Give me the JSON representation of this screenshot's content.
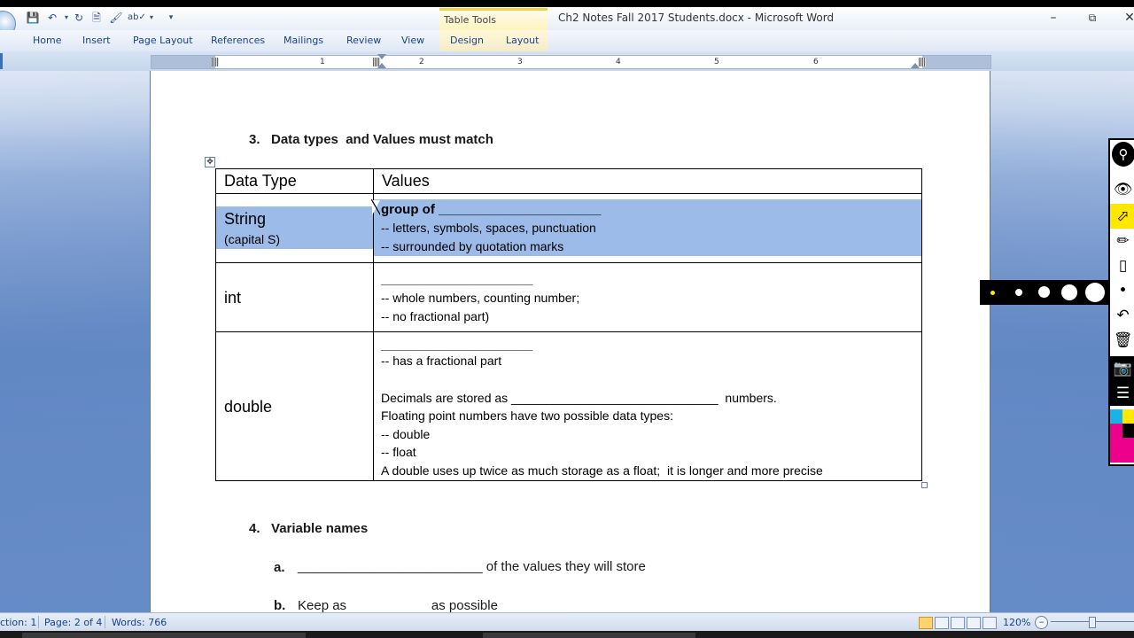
{
  "window": {
    "title": "Ch2 Notes Fall 2017 Students.docx - Microsoft Word",
    "context_tab_group": "Table Tools"
  },
  "ribbon_tabs": [
    "Home",
    "Insert",
    "Page Layout",
    "References",
    "Mailings",
    "Review",
    "View",
    "Design",
    "Layout"
  ],
  "ruler_numbers": [
    "1",
    "2",
    "3",
    "4",
    "5",
    "6"
  ],
  "document": {
    "heading3": "3.   Data types  and Values must match",
    "table": {
      "col1_header": "Data Type",
      "col2_header": "Values",
      "rows": [
        {
          "type": "String",
          "type_sub": "(capital S)",
          "lines": [
            "group of ______________________",
            "-- letters, symbols, spaces, punctuation",
            "-- surrounded by quotation marks"
          ]
        },
        {
          "type": "int",
          "type_sub": "",
          "lines": [
            "______________________",
            "-- whole numbers, counting number;",
            "-- no fractional part)"
          ]
        },
        {
          "type": "double",
          "type_sub": "",
          "lines": [
            "______________________",
            "-- has a fractional part",
            "",
            "Decimals are stored as ______________________________  numbers.",
            "Floating point numbers have two possible data types:",
            "-- double",
            "-- float",
            "A double uses up twice as much storage as a float;  it is longer and more precise"
          ]
        }
      ]
    },
    "heading4": "4.   Variable names",
    "item_a_label": "a.",
    "item_a_text": "_________________________ of the values they will store",
    "item_b_label": "b.",
    "item_b_text": "Keep as                       as possible"
  },
  "status": {
    "section": "ction: 1",
    "page": "Page: 2 of 4",
    "words": "Words: 766",
    "zoom": "120%"
  },
  "colors": {
    "selection": "#9dbbe9",
    "ribbon_text": "#15428b",
    "context_tab": "#f3d24a"
  }
}
